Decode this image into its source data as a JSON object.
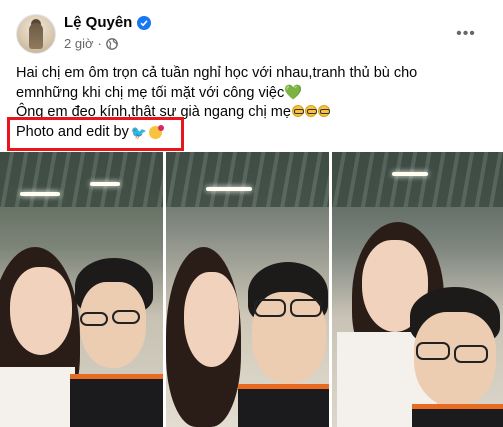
{
  "author": {
    "name": "Lệ Quyên",
    "time": "2 giờ",
    "separator": "·"
  },
  "icons": {
    "verified": "verified-badge-icon",
    "privacy": "globe-icon",
    "more": "more-options-icon"
  },
  "more_label": "•••",
  "post": {
    "line1": "Hai chị em ôm trọn cả tuần nghỉ học với nhau,tranh thủ bù cho",
    "line2": "emnhững khi chị mẹ tối mặt với công việc",
    "line2_emoji": "💚",
    "line3": "Ông em đeo kính,thật sự già ngang chị mẹ",
    "line4": "Photo and edit by",
    "line4_emoji_bird": "🐦"
  },
  "colors": {
    "accent": "#1877f2",
    "highlight": "#e8161b",
    "meta_text": "#65676b"
  },
  "photos": [
    {
      "name": "photo-1"
    },
    {
      "name": "photo-2"
    },
    {
      "name": "photo-3"
    }
  ]
}
